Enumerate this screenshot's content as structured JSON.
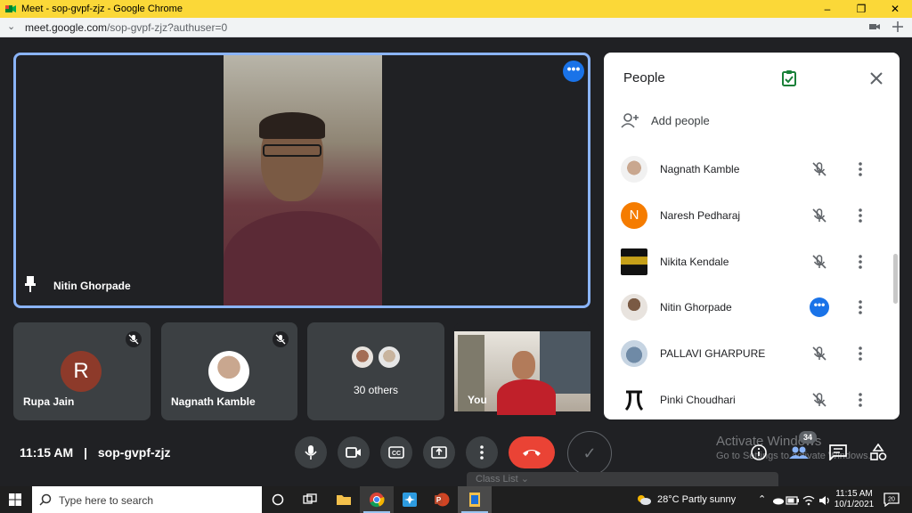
{
  "browser": {
    "title": "Meet - sop-gvpf-zjz - Google Chrome",
    "url_host": "meet.google.com",
    "url_path": "/sop-gvpf-zjz?authuser=0",
    "controls": [
      "–",
      "❐",
      "✕"
    ]
  },
  "stage": {
    "pinned_name": "Nitin Ghorpade",
    "more_label": "•••"
  },
  "tiles": [
    {
      "name": "Rupa Jain",
      "avatar_letter": "R",
      "muted": true
    },
    {
      "name": "Nagnath Kamble",
      "muted": true
    },
    {
      "label": "30 others"
    },
    {
      "name": "You"
    }
  ],
  "people_panel": {
    "title": "People",
    "add_people_label": "Add people",
    "participants": [
      {
        "name": "Nagnath Kamble",
        "status": "muted"
      },
      {
        "name": "Naresh Pedharaj",
        "avatar_letter": "N",
        "avatar_color": "#f57c00",
        "status": "muted"
      },
      {
        "name": "Nikita Kendale",
        "status": "muted"
      },
      {
        "name": "Nitin Ghorpade",
        "status": "speaking"
      },
      {
        "name": "PALLAVI GHARPURE",
        "status": "muted"
      },
      {
        "name": "Pinki Choudhari",
        "status": "muted"
      }
    ]
  },
  "bottom_bar": {
    "time": "11:15 AM",
    "separator": "|",
    "meeting_code": "sop-gvpf-zjz",
    "participants_badge": "34",
    "end_call_color": "#ea4335"
  },
  "watermark": {
    "line1": "Activate Windows",
    "line2": "Go to Settings to activate Windows."
  },
  "overlay": {
    "class_list_label": "Class List"
  },
  "taskbar": {
    "search_placeholder": "Type here to search",
    "weather": "28°C  Partly sunny",
    "time": "11:15 AM",
    "date": "10/1/2021"
  }
}
